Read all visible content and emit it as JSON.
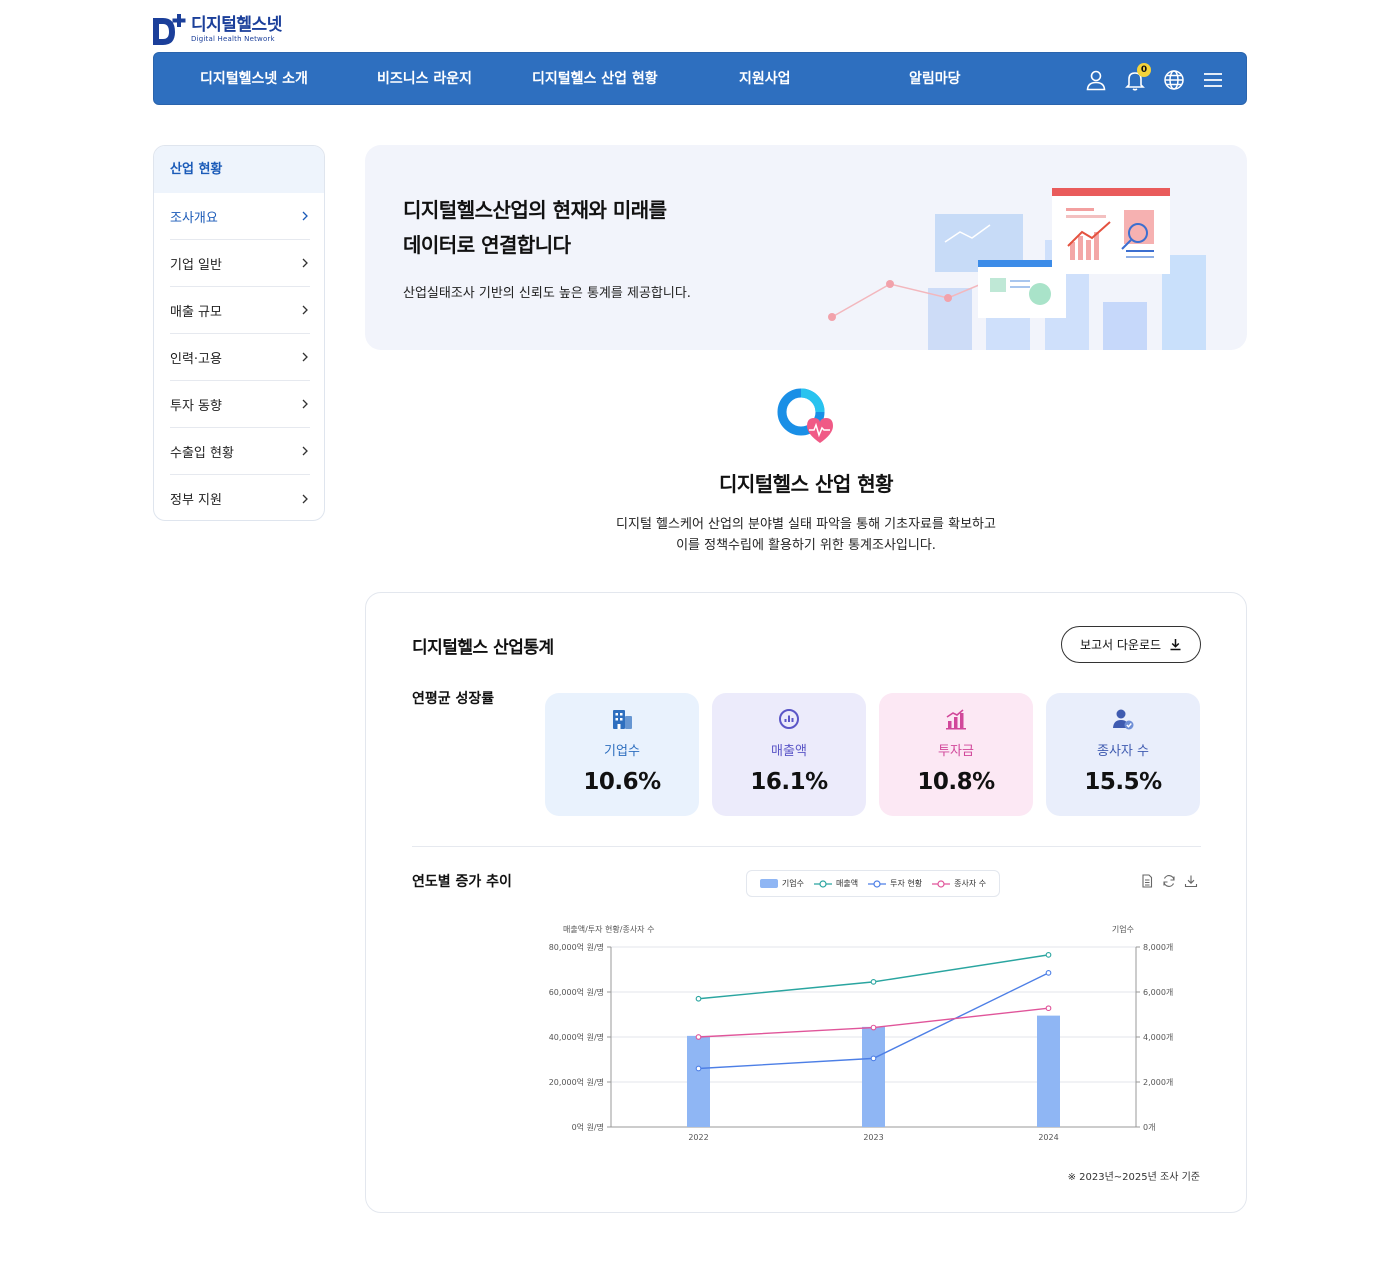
{
  "logo": {
    "name": "디지털헬스넷",
    "sub": "Digital Health Network"
  },
  "nav": {
    "items": [
      {
        "label": "디지털헬스넷 소개"
      },
      {
        "label": "비즈니스 라운지"
      },
      {
        "label": "디지털헬스 산업 현황"
      },
      {
        "label": "지원사업"
      },
      {
        "label": "알림마당"
      }
    ],
    "bell_count": "0",
    "icons": [
      "user-icon",
      "bell-icon",
      "globe-icon",
      "menu-icon"
    ]
  },
  "sidebar": {
    "heading": "산업 현황",
    "items": [
      {
        "label": "조사개요",
        "active": true
      },
      {
        "label": "기업 일반"
      },
      {
        "label": "매출 규모"
      },
      {
        "label": "인력·고용"
      },
      {
        "label": "투자 동향"
      },
      {
        "label": "수출입 현황"
      },
      {
        "label": "정부 지원"
      }
    ]
  },
  "hero": {
    "title_line1": "디지털헬스산업의 현재와 미래를",
    "title_line2": "데이터로 연결합니다",
    "description": "산업실태조사 기반의 신뢰도 높은 통계를 제공합니다."
  },
  "intro": {
    "title": "디지털헬스 산업 현황",
    "desc_line1": "디지털 헬스케어 산업의 분야별 실태 파악을 통해 기초자료를 확보하고",
    "desc_line2": "이를 정책수립에 활용하기 위한 통계조사입니다."
  },
  "stats": {
    "title": "디지털헬스 산업통계",
    "download_label": "보고서 다운로드",
    "growth_label": "연평균 성장률",
    "metrics": [
      {
        "label": "기업수",
        "value": "10.6%",
        "icon": "building-icon",
        "bg": "#e9f2fd",
        "color": "#2e6fbf"
      },
      {
        "label": "매출액",
        "value": "16.1%",
        "icon": "chart-circle-icon",
        "bg": "#ecebfb",
        "color": "#5b56c7"
      },
      {
        "label": "투자금",
        "value": "10.8%",
        "icon": "bar-chart-icon",
        "bg": "#fce8f4",
        "color": "#d1479a"
      },
      {
        "label": "종사자 수",
        "value": "15.5%",
        "icon": "person-check-icon",
        "bg": "#e9eefb",
        "color": "#3f5bb0"
      }
    ],
    "trend_title": "연도별 증가 추이",
    "footnote": "※ 2023년~2025년 조사 기준"
  },
  "chart_data": {
    "type": "bar",
    "categories": [
      "2022",
      "2023",
      "2024"
    ],
    "series": [
      {
        "name": "기업수",
        "kind": "bar",
        "axis": "right",
        "color": "#8fb6f4",
        "values": [
          4050,
          4450,
          4950
        ]
      },
      {
        "name": "매출액",
        "kind": "line",
        "axis": "left",
        "color": "#2aa5a0",
        "values": [
          57000,
          64500,
          76500
        ]
      },
      {
        "name": "투자 현황",
        "kind": "line",
        "axis": "left",
        "color": "#4d7fe6",
        "values": [
          26000,
          30500,
          68500
        ]
      },
      {
        "name": "종사자 수",
        "kind": "line",
        "axis": "left",
        "color": "#e0559a",
        "values": [
          40000,
          44200,
          52800
        ]
      }
    ],
    "ylabel": "매출액/투자 현황/종사자 수",
    "y2label": "기업수",
    "ylim": [
      0,
      80000
    ],
    "y2lim": [
      0,
      8000
    ],
    "yticks": [
      "0억 원/명",
      "20,000억 원/명",
      "40,000억 원/명",
      "60,000억 원/명",
      "80,000억 원/명"
    ],
    "y2ticks": [
      "0개",
      "2,000개",
      "4,000개",
      "6,000개",
      "8,000개"
    ],
    "grid": true,
    "legend": "top-center"
  }
}
